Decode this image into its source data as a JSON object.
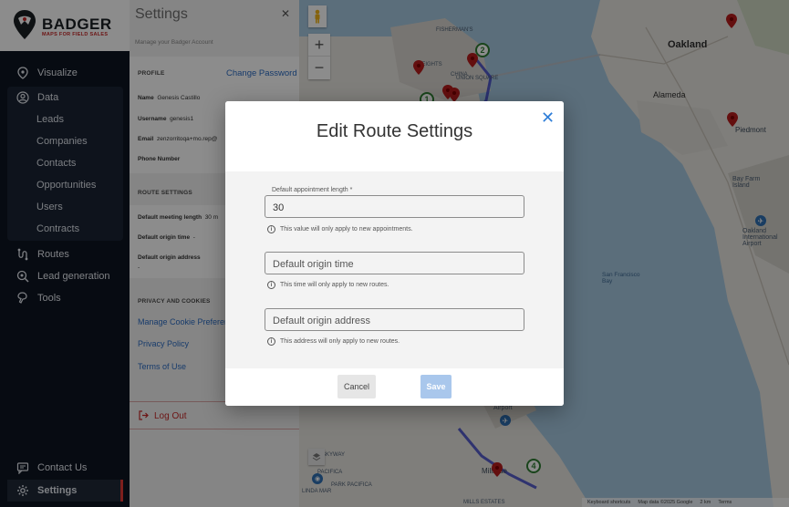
{
  "brand": {
    "name": "BADGER",
    "tagline": "MAPS FOR FIELD SALES"
  },
  "nav": {
    "visualize": "Visualize",
    "data": "Data",
    "data_items": [
      "Leads",
      "Companies",
      "Contacts",
      "Opportunities",
      "Users",
      "Contracts"
    ],
    "routes": "Routes",
    "lead_generation": "Lead generation",
    "tools": "Tools",
    "contact_us": "Contact Us",
    "settings": "Settings"
  },
  "settings": {
    "title": "Settings",
    "close": "✕",
    "subtitle": "Manage your Badger Account",
    "profile_header": "PROFILE",
    "change_password": "Change Password",
    "name_label": "Name",
    "name_value": "Genesis Castillo",
    "username_label": "Username",
    "username_value": "genesis1",
    "email_label": "Email",
    "email_value": "zenzorritoqa+mo.rep@",
    "phone_label": "Phone Number",
    "route_header": "ROUTE SETTINGS",
    "meeting_length_label": "Default meeting length",
    "meeting_length_value": "30 m",
    "origin_time_label": "Default origin time",
    "origin_time_value": "-",
    "origin_address_label": "Default origin address",
    "origin_address_value": "-",
    "privacy_header": "PRIVACY AND COOKIES",
    "manage_cookies": "Manage Cookie Preferen",
    "privacy_policy": "Privacy Policy",
    "terms": "Terms of Use",
    "logout": "Log Out"
  },
  "map": {
    "labels": {
      "oakland": "Oakland",
      "alameda": "Alameda",
      "piedmont": "Piedmont",
      "bay_farm": "Bay Farm\nIsland",
      "oak_airport": "Oakland\nInternational\nAirport",
      "sf_bay": "San Francisco\nBay",
      "fishermans": "FISHERMAN'S",
      "chinatown": "CHINA",
      "union_sq": "UNION SQUARE",
      "heights": "HEIGHTS",
      "millbrae": "Millbrae",
      "airport": "Airport",
      "linda_mar": "LINDA MAR",
      "park_pacifica": "PARK PACIFICA",
      "skyway": "SKYWAY",
      "mills_estates": "MILLS ESTATES",
      "pacifica": "PACIFICA"
    },
    "markers": [
      "1",
      "2",
      "4"
    ],
    "footer": {
      "shortcuts": "Keyboard shortcuts",
      "map_data": "Map data ©2025 Google",
      "scale": "2 km",
      "terms": "Terms"
    }
  },
  "modal": {
    "title": "Edit Route Settings",
    "close": "✕",
    "appointment_label": "Default appointment length *",
    "appointment_value": "30",
    "appointment_hint": "This value will only apply to new appointments.",
    "origin_time_placeholder": "Default origin time",
    "origin_time_hint": "This time will only apply to new routes.",
    "origin_address_placeholder": "Default origin address",
    "origin_address_hint": "This address will only apply to new routes.",
    "cancel": "Cancel",
    "save": "Save"
  },
  "colors": {
    "accent": "#2f7ed8",
    "brand_red": "#c62828",
    "sidebar_bg": "#0e1522",
    "save_disabled": "#a9c7ec"
  }
}
